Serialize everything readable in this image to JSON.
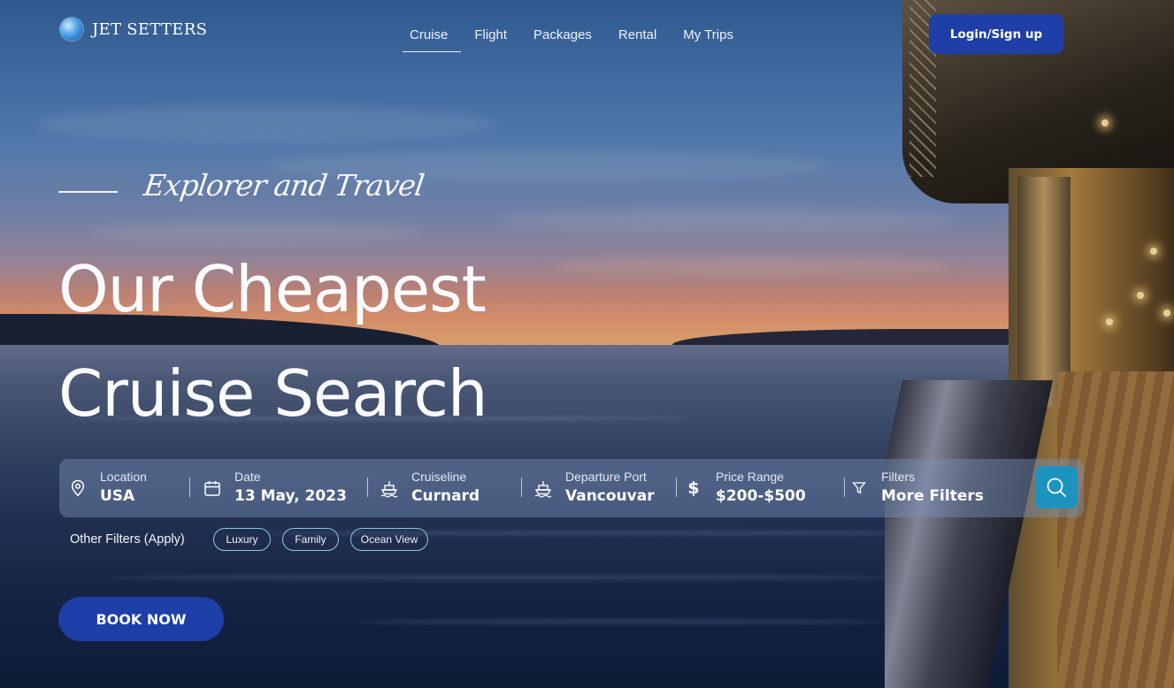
{
  "brand": {
    "name": "JET SETTERS",
    "logo_icon": "globe-icon"
  },
  "nav": {
    "items": [
      {
        "label": "Cruise",
        "active": true
      },
      {
        "label": "Flight"
      },
      {
        "label": "Packages"
      },
      {
        "label": "Rental"
      },
      {
        "label": "My Trips"
      }
    ],
    "login_label": "Login/Sign up"
  },
  "hero": {
    "tagline": "Explorer and Travel",
    "headline_line1": "Our Cheapest",
    "headline_line2": "Cruise Search"
  },
  "search": {
    "fields": [
      {
        "icon": "map-pin-icon",
        "label": "Location",
        "value": "USA"
      },
      {
        "icon": "calendar-icon",
        "label": "Date",
        "value": "13 May, 2023"
      },
      {
        "icon": "ship-icon",
        "label": "Cruiseline",
        "value": "Curnard"
      },
      {
        "icon": "ship-icon",
        "label": "Departure Port",
        "value": "Vancouvar"
      },
      {
        "icon": "dollar-icon",
        "label": "Price Range",
        "value": "$200-$500"
      },
      {
        "icon": "filter-icon",
        "label": "Filters",
        "value": "More Filters"
      }
    ],
    "button_icon": "search-icon"
  },
  "other_filters": {
    "label": "Other Filters (Apply)",
    "chips": [
      "Luxury",
      "Family",
      "Ocean View"
    ]
  },
  "cta": {
    "book_label": "BOOK NOW"
  },
  "colors": {
    "primary": "#1e3fa8",
    "search_button": "#1c93bf",
    "chip_border": "#8fc7de"
  }
}
